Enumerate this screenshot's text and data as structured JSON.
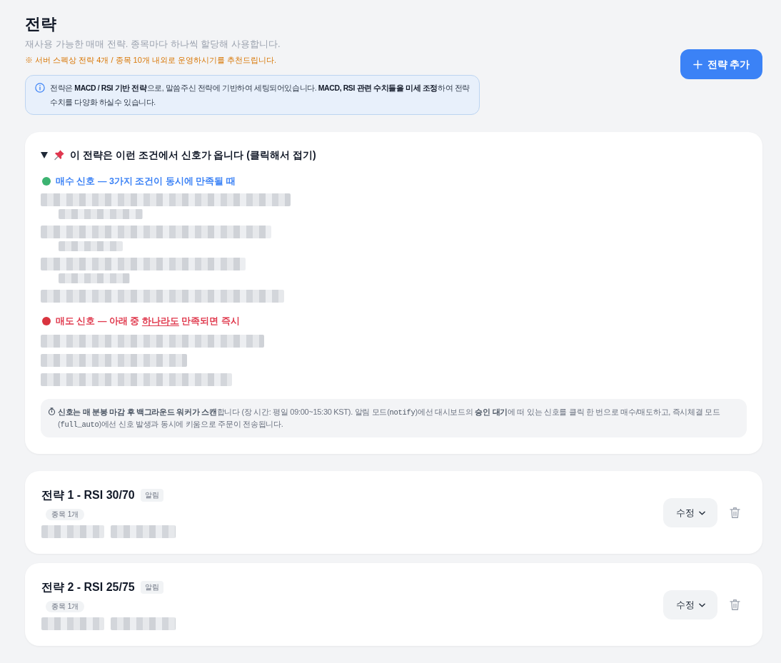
{
  "header": {
    "title": "전략",
    "subtitle": "재사용 가능한 매매 전략. 종목마다 하나씩 할당해 사용합니다.",
    "notice": "※ 서버 스펙상 전략 4개 / 종목 10개 내외로 운영하시기를 추천드립니다.",
    "info": "전략은 **MACD / RSI 기반 전략**으로, 말씀주신 전략에 기반하여 세팅되어있습니다. **MACD, RSI 관련 수치들을 미세 조정**하여 전략 수치를 다양화 하실수 있습니다.",
    "add_button": "전략 추가"
  },
  "signal_guide": {
    "title": "이 전략은 이런 조건에서 신호가 옵니다 (클릭해서 접기)",
    "expanded": true,
    "signals": [
      {
        "kind": "buy",
        "color": "#3cb371",
        "title_parts": [
          {
            "text": "매수 신호 — 3가지 조건이 동시에 만족될 때",
            "underline": false
          }
        ],
        "conditions": [
          {
            "kind": "redacted",
            "children": [
              {
                "kind": "redacted"
              }
            ]
          },
          {
            "kind": "redacted",
            "children": [
              {
                "kind": "redacted"
              }
            ]
          },
          {
            "kind": "redacted",
            "children": [
              {
                "kind": "redacted"
              }
            ]
          },
          {
            "kind": "redacted"
          }
        ]
      },
      {
        "kind": "sell",
        "color": "#d9343f",
        "title_parts": [
          {
            "text": "매도 신호 — 아래 중 ",
            "underline": false
          },
          {
            "text": "하나라도",
            "underline": true
          },
          {
            "text": " 만족되면 즉시",
            "underline": false
          }
        ],
        "conditions": [
          {
            "kind": "redacted"
          },
          {
            "kind": "redacted"
          },
          {
            "kind": "redacted"
          }
        ]
      }
    ],
    "note": [
      {
        "kind": "bold",
        "text": "신호는 매 분봉 마감 후 백그라운드 워커가 스캔"
      },
      {
        "kind": "plain",
        "text": "합니다 (장 시간: 평일 09:00~15:30 KST). 알림 모드("
      },
      {
        "kind": "code",
        "text": "notify"
      },
      {
        "kind": "plain",
        "text": ")에선 대시보드의 "
      },
      {
        "kind": "bold",
        "text": "승인 대기"
      },
      {
        "kind": "plain",
        "text": "에 떠 있는 신호를 클릭 한 번으로 매수/매도하고, 즉시체결 모드("
      },
      {
        "kind": "code",
        "text": "full_auto"
      },
      {
        "kind": "plain",
        "text": ")에선 신호 발생과 동시에 키움으로 주문이 전송됩니다."
      }
    ]
  },
  "strategies": [
    {
      "name": "전략 1 - RSI 30/70",
      "mode": "알림",
      "stock_count": "종목 1개",
      "details": [
        {
          "kind": "redacted"
        },
        {
          "kind": "redacted"
        }
      ],
      "edit_button": "수정"
    },
    {
      "name": "전략 2 - RSI 25/75",
      "mode": "알림",
      "stock_count": "종목 1개",
      "details": [
        {
          "kind": "redacted"
        },
        {
          "kind": "redacted"
        }
      ],
      "edit_button": "수정"
    }
  ]
}
